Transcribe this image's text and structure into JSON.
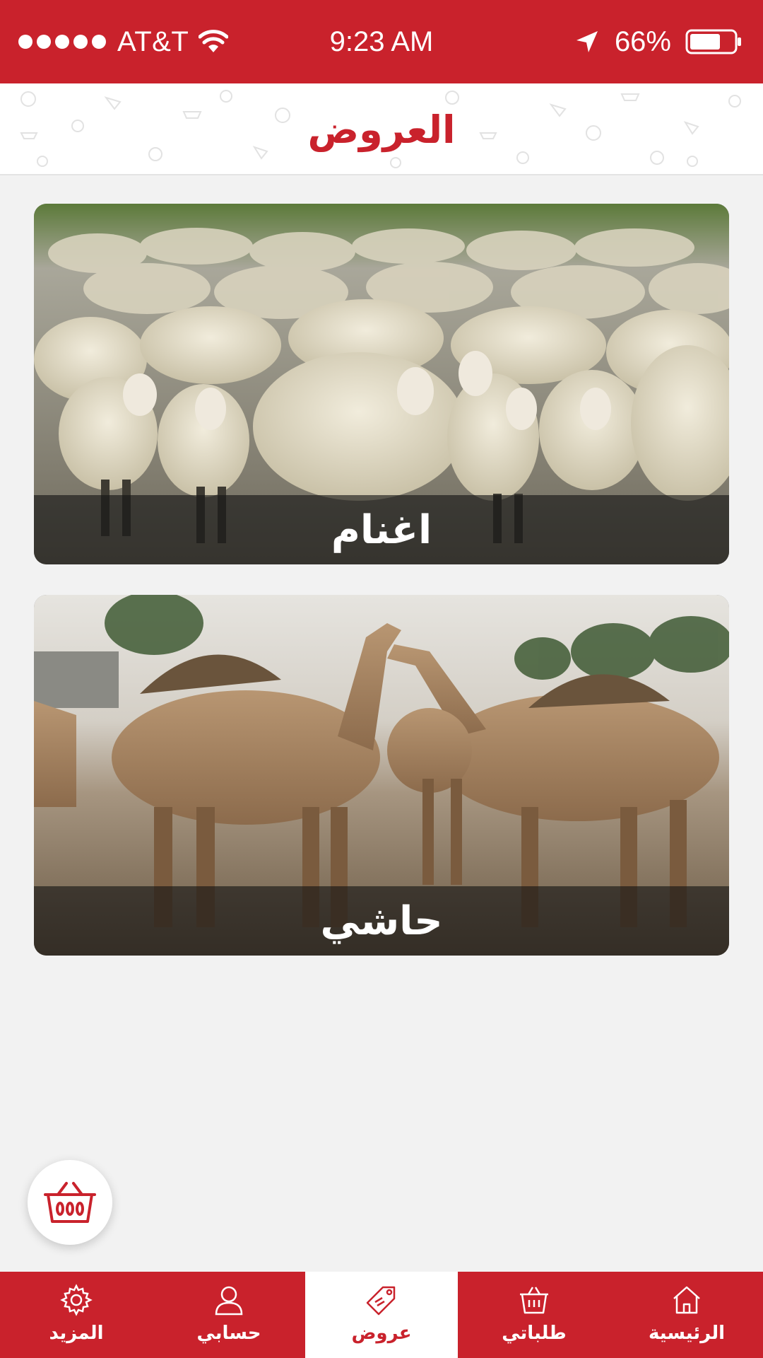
{
  "status_bar": {
    "carrier": "AT&T",
    "time": "9:23 AM",
    "battery": "66%",
    "signal_bars": 5,
    "battery_level": 0.66,
    "icons": [
      "wifi-icon",
      "location-icon",
      "battery-icon"
    ]
  },
  "header": {
    "title": "العروض"
  },
  "offers": [
    {
      "label": "اغنام",
      "image": "sheep-flock-photo"
    },
    {
      "label": "حاشي",
      "image": "camels-photo"
    }
  ],
  "cart_button": {
    "icon": "basket-icon"
  },
  "tabs": [
    {
      "label": "المزيد",
      "icon": "gear-icon",
      "active": false
    },
    {
      "label": "حسابي",
      "icon": "user-icon",
      "active": false
    },
    {
      "label": "عروض",
      "icon": "tag-icon",
      "active": true
    },
    {
      "label": "طلباتي",
      "icon": "basket-icon",
      "active": false
    },
    {
      "label": "الرئيسية",
      "icon": "home-icon",
      "active": false
    }
  ],
  "colors": {
    "brand_red": "#c9222c",
    "background": "#f2f2f2",
    "white": "#ffffff"
  }
}
